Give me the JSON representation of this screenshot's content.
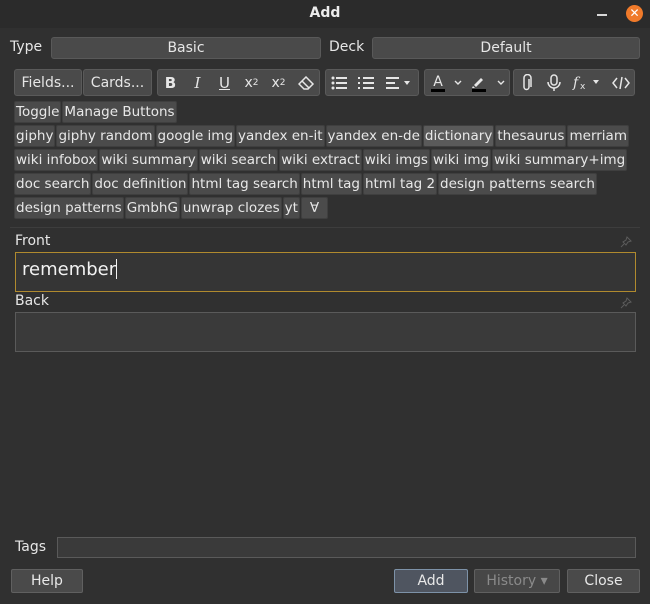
{
  "window": {
    "title": "Add"
  },
  "note_type": {
    "label": "Type",
    "value": "Basic"
  },
  "deck": {
    "label": "Deck",
    "value": "Default"
  },
  "toolbar": {
    "fields_label": "Fields...",
    "cards_label": "Cards..."
  },
  "buttons": {
    "row1": [
      "Toggle",
      "Manage Buttons"
    ],
    "row2": [
      "giphy",
      "giphy random",
      "google img",
      "yandex en-it",
      "yandex en-de",
      "dictionary",
      "thesaurus",
      "merriam"
    ],
    "row3": [
      "wiki infobox",
      "wiki summary",
      "wiki search",
      "wiki extract",
      "wiki imgs",
      "wiki img",
      "wiki summary+img"
    ],
    "row4": [
      "doc search",
      "doc definition",
      "html tag search",
      "html tag",
      "html tag 2",
      "design patterns search"
    ],
    "row5": [
      "design patterns",
      "GmbhG",
      "unwrap clozes",
      "yt",
      "∀"
    ]
  },
  "fields": [
    {
      "label": "Front",
      "value": "remember"
    },
    {
      "label": "Back",
      "value": ""
    }
  ],
  "tags": {
    "label": "Tags",
    "value": ""
  },
  "bottom": {
    "help": "Help",
    "add": "Add",
    "history": "History ▾",
    "close": "Close"
  }
}
